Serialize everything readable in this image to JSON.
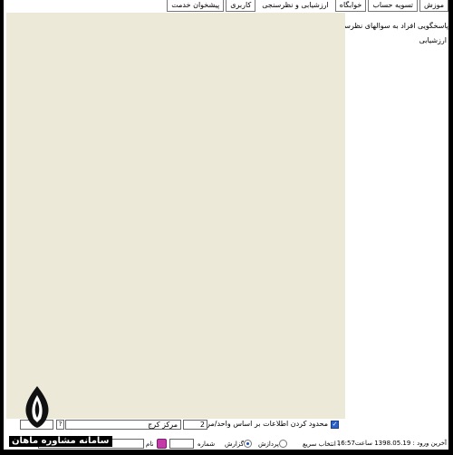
{
  "tabs": [
    {
      "label": "موزش",
      "active": false
    },
    {
      "label": "تسویه حساب",
      "active": false
    },
    {
      "label": "خوابگاه",
      "active": false
    },
    {
      "label": "ارزشیابی و نظرسنجی",
      "active": true
    },
    {
      "label": "کاربری",
      "active": false
    },
    {
      "label": "پیشخوان خدمت",
      "active": false
    }
  ],
  "side": {
    "title": "پاسخگویی افراد به سوالهای نظرسنجی",
    "subtitle": "ارزشیابی"
  },
  "filter": {
    "checked": true,
    "label": "محدود کردن اطلاعات بر اساس واحد/مرکز",
    "center_code": "2",
    "center_name": "مرکز کرج",
    "help": "?"
  },
  "footer": {
    "last_login": "آخرین ورود : 1398.05.19 ساعت16:57",
    "quick_select": "انتخاب سریع :",
    "option_process": "پردازش",
    "option_report": "گزارش",
    "number_label": "شماره",
    "name_label": "نام",
    "selected_option": "report"
  },
  "watermark": {
    "text": "سامانه مشاوره ماهان"
  },
  "colors": {
    "panel_bg": "#ece9d8",
    "checkbox": "#2a62c9",
    "name_icon": "#c33aa8"
  }
}
